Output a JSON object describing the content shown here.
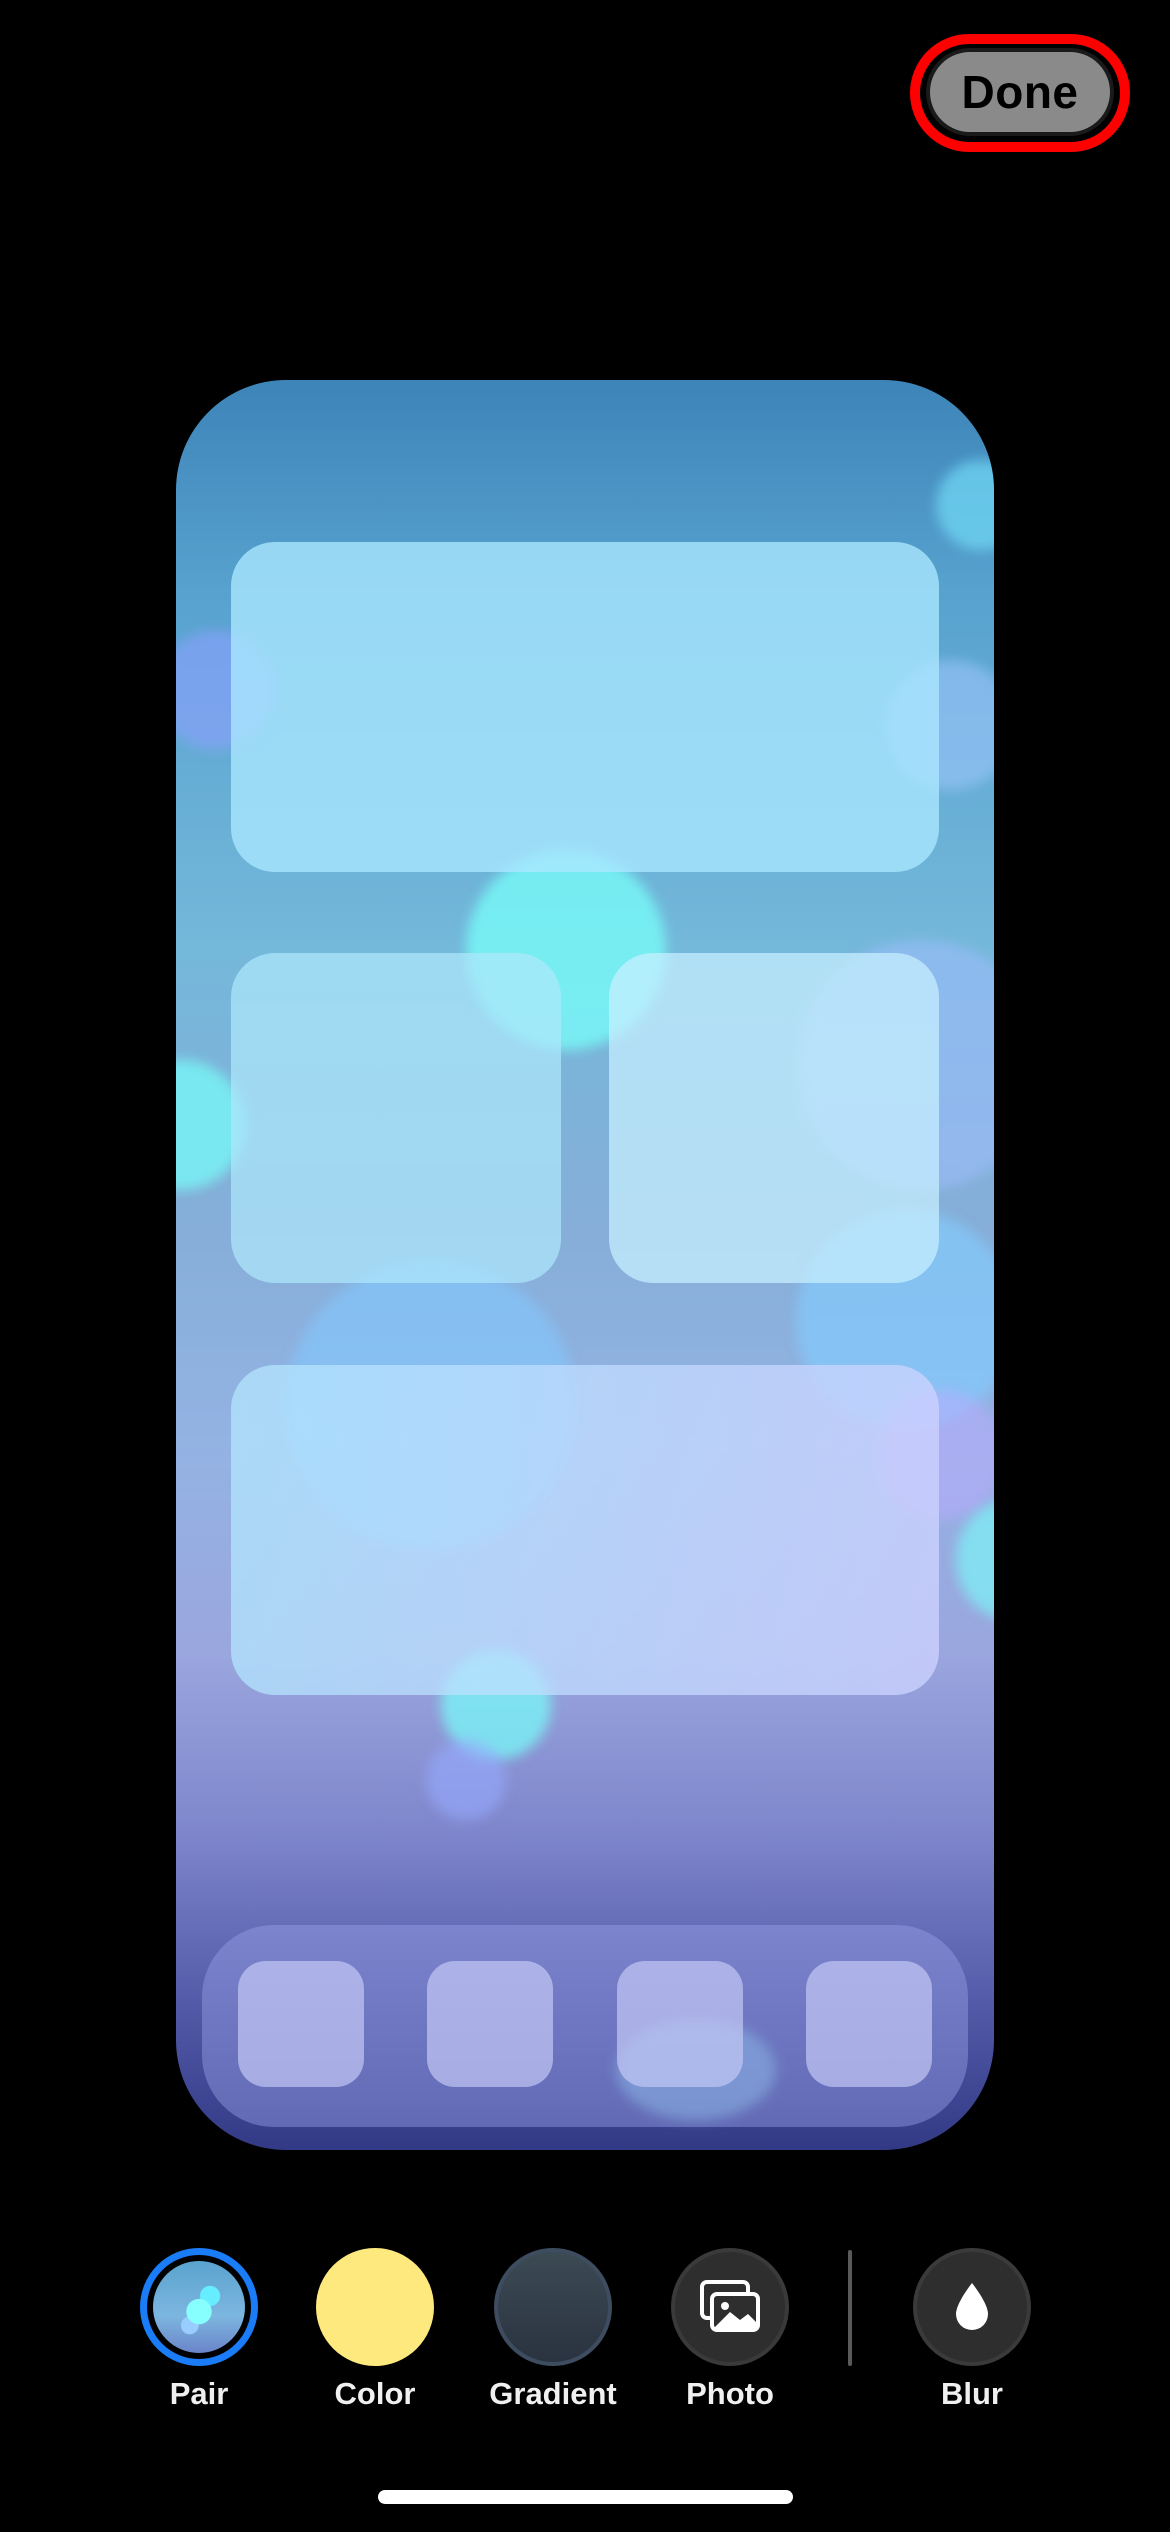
{
  "header": {
    "done_label": "Done"
  },
  "preview": {
    "description_free": true
  },
  "style_picker": {
    "options": [
      {
        "label": "Pair",
        "icon": "pair-preview-icon",
        "selected": true
      },
      {
        "label": "Color",
        "icon": "color-swatch-icon",
        "color": "#fde97e"
      },
      {
        "label": "Gradient",
        "icon": "gradient-swatch-icon"
      },
      {
        "label": "Photo",
        "icon": "photo-gallery-icon"
      },
      {
        "label": "Blur",
        "icon": "drop-icon"
      }
    ]
  },
  "colors": {
    "accent": "#1a7cf6",
    "done_highlight": "#ff0000"
  }
}
